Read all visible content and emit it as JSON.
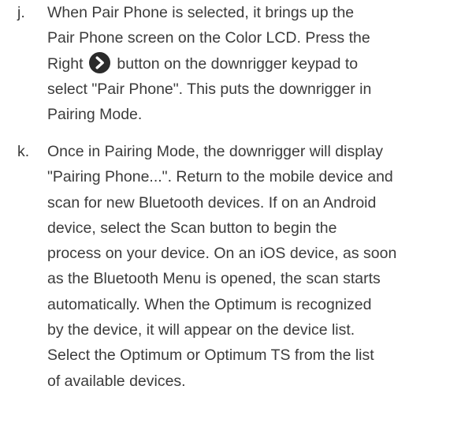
{
  "steps": [
    {
      "letter": "j.",
      "lines": [
        "When Pair Phone is selected, it brings up the",
        "Pair Phone screen on the Color LCD. Press the",
        "Right",
        "button on the downrigger keypad to",
        "select \"Pair Phone\". This puts the downrigger in",
        "Pairing Mode."
      ],
      "icon": "right-arrow-button-icon"
    },
    {
      "letter": "k.",
      "lines": [
        "Once in Pairing Mode, the downrigger will display",
        "\"Pairing Phone...\". Return to the mobile device and",
        "scan for new Bluetooth devices. If on an Android",
        "device, select the Scan button to begin the",
        "process on your device. On an iOS device, as soon",
        "as the Bluetooth Menu is opened, the scan starts",
        "automatically. When the Optimum is recognized",
        "by the device, it will appear on the device list.",
        "Select the Optimum or Optimum TS from the list",
        "of available devices."
      ]
    }
  ],
  "colors": {
    "text": "#3b3b3b",
    "icon_fill": "#2b2b2b",
    "icon_glyph": "#ffffff"
  }
}
